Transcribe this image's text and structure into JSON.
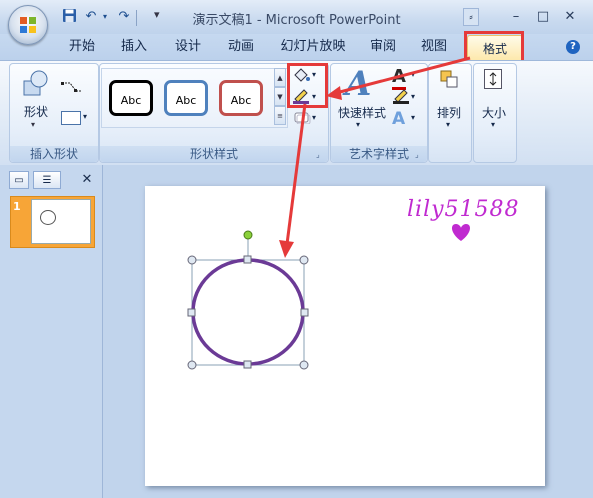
{
  "window": {
    "title": "演示文稿1 - Microsoft PowerPoint",
    "controls": [
      "–",
      "□",
      "✕"
    ],
    "extra_icon": "ribbon-collapse-icon"
  },
  "quick_access": {
    "icons": [
      "save-icon",
      "undo-icon",
      "redo-icon"
    ]
  },
  "tabs": [
    {
      "label": "开始"
    },
    {
      "label": "插入"
    },
    {
      "label": "设计"
    },
    {
      "label": "动画"
    },
    {
      "label": "幻灯片放映"
    },
    {
      "label": "审阅"
    },
    {
      "label": "视图"
    },
    {
      "label": "格式"
    }
  ],
  "ribbon": {
    "insert_shapes": {
      "group_label": "插入形状",
      "shapes_label": "形状"
    },
    "shape_styles": {
      "group_label": "形状样式",
      "gallery": [
        {
          "label": "Abc",
          "border": "#000000"
        },
        {
          "label": "Abc",
          "border": "#4f81bd"
        },
        {
          "label": "Abc",
          "border": "#c0504d"
        }
      ],
      "fill_icon": "shape-fill-icon",
      "outline_icon": "shape-outline-icon",
      "effects_icon": "shape-effects-icon"
    },
    "wordart": {
      "group_label": "艺术字样式",
      "quick_styles_label": "快速样式"
    },
    "arrange": {
      "label": "排列"
    },
    "size": {
      "label": "大小"
    }
  },
  "left_pane": {
    "slide_number": "1"
  },
  "slide": {
    "watermark": "lily51588"
  },
  "colors": {
    "highlight": "#e53a3a",
    "ellipse_outline": "#6b3a96",
    "rotation_handle": "#8bd13a",
    "watermark": "#c02ad0"
  }
}
